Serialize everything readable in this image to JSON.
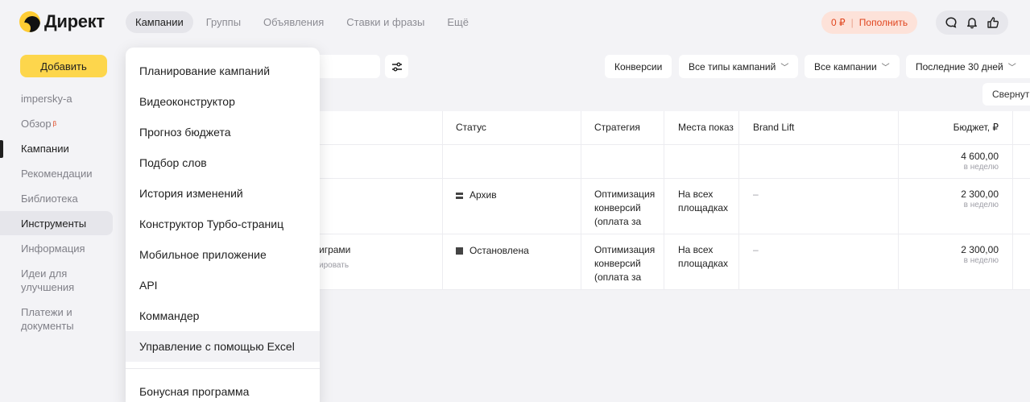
{
  "app": {
    "logo_text": "Директ"
  },
  "top_tabs": [
    {
      "label": "Кампании",
      "active": true
    },
    {
      "label": "Группы"
    },
    {
      "label": "Объявления"
    },
    {
      "label": "Ставки и фразы"
    },
    {
      "label": "Ещё"
    }
  ],
  "balance": {
    "amount": "0 ₽",
    "topup_label": "Пополнить"
  },
  "header_icons": [
    "chat-icon",
    "bell-icon",
    "thumbs-up-icon"
  ],
  "sidebar": {
    "add_label": "Добавить",
    "items": [
      {
        "label": "impersky-a"
      },
      {
        "label": "Обзор",
        "badge": "β"
      },
      {
        "label": "Кампании",
        "active": true
      },
      {
        "label": "Рекомендации"
      },
      {
        "label": "Библиотека"
      },
      {
        "label": "Инструменты",
        "highlighted": true
      },
      {
        "label": "Информация"
      },
      {
        "label": "Идеи для улучшения"
      },
      {
        "label": "Платежи и документы"
      }
    ]
  },
  "toolbar": {
    "conversions_label": "Конверсии",
    "campaign_types_label": "Все типы кампаний",
    "campaigns_label": "Все кампании",
    "period_label": "Последние 30 дней",
    "collapse_label": "Свернуть"
  },
  "table": {
    "columns": [
      "Статус",
      "Стратегия",
      "Места показов",
      "Brand Lift",
      "Бюджет, ₽"
    ],
    "columns_visible_text": [
      "Статус",
      "Стратегия",
      "Места показ",
      "Brand Lift",
      "Бюджет, ₽"
    ],
    "total": {
      "budget": "4 600,00",
      "budget_period": "в неделю"
    },
    "rows": [
      {
        "name": "",
        "name_sub": "",
        "status": "Архив",
        "strategy": "Оптимизация конверсий (оплата за",
        "places": "На всех площадках",
        "brand_lift": "–",
        "budget": "2 300,00",
        "budget_period": "в неделю"
      },
      {
        "name": "играми",
        "name_sub": "ировать",
        "status": "Остановлена",
        "strategy": "Оптимизация конверсий (оплата за",
        "places": "На всех площадках",
        "brand_lift": "–",
        "budget": "2 300,00",
        "budget_period": "в неделю"
      }
    ]
  },
  "tools_menu": {
    "items": [
      "Планирование кампаний",
      "Видеоконструктор",
      "Прогноз бюджета",
      "Подбор слов",
      "История изменений",
      "Конструктор Турбо-страниц",
      "Мобильное приложение",
      "API",
      "Коммандер",
      "Управление с помощью Excel"
    ],
    "hovered_item": "Управление с помощью Excel",
    "bottom_items": [
      "Бонусная программа"
    ]
  },
  "colors": {
    "accent_yellow": "#fdd64c",
    "balance_red": "#e0451e",
    "balance_bg": "#fde2d9",
    "page_bg": "#f3f3f6"
  }
}
